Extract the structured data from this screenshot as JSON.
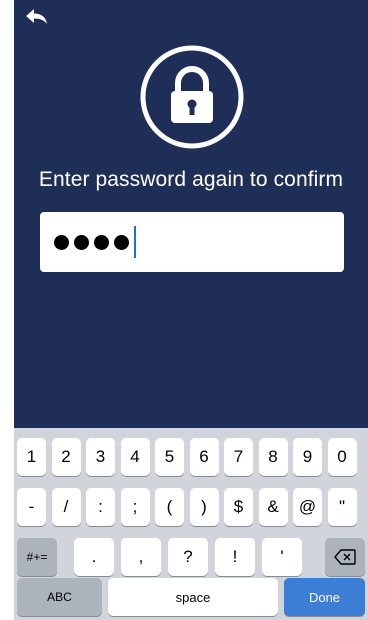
{
  "prompt": "Enter password again to confirm",
  "password": {
    "masked_length": 4
  },
  "keyboard": {
    "row1": [
      "1",
      "2",
      "3",
      "4",
      "5",
      "6",
      "7",
      "8",
      "9",
      "0"
    ],
    "row2": [
      "-",
      "/",
      ":",
      ";",
      "(",
      ")",
      "$",
      "&",
      "@",
      "\""
    ],
    "row3_mode": "#+=",
    "row3": [
      ".",
      ",",
      "?",
      "!",
      "'"
    ],
    "abc": "ABC",
    "space": "space",
    "done": "Done"
  },
  "colors": {
    "background": "#1f2e57",
    "keyboard": "#d1d4da",
    "done": "#3c7ed6"
  },
  "icons": [
    "back-arrow-icon",
    "lock-icon",
    "backspace-icon"
  ]
}
